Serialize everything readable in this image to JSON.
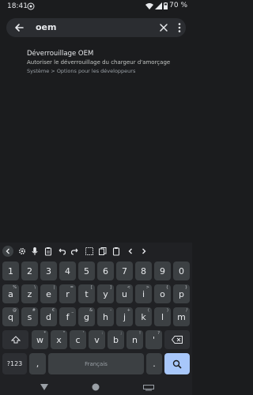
{
  "status": {
    "time": "18:41",
    "battery": "70 %"
  },
  "search": {
    "query": "oem"
  },
  "result": {
    "title": "Déverrouillage OEM",
    "summary": "Autoriser le déverrouillage du chargeur d'amorçage",
    "path": "Système > Options pour les développeurs"
  },
  "keyboard": {
    "row1": [
      {
        "main": "1",
        "hint": ""
      },
      {
        "main": "2",
        "hint": ""
      },
      {
        "main": "3",
        "hint": ""
      },
      {
        "main": "4",
        "hint": ""
      },
      {
        "main": "5",
        "hint": ""
      },
      {
        "main": "6",
        "hint": ""
      },
      {
        "main": "7",
        "hint": ""
      },
      {
        "main": "8",
        "hint": ""
      },
      {
        "main": "9",
        "hint": ""
      },
      {
        "main": "0",
        "hint": ""
      }
    ],
    "row2": [
      {
        "main": "a",
        "hint": "%"
      },
      {
        "main": "z",
        "hint": "\\"
      },
      {
        "main": "e",
        "hint": "|"
      },
      {
        "main": "r",
        "hint": "="
      },
      {
        "main": "t",
        "hint": "["
      },
      {
        "main": "y",
        "hint": "]"
      },
      {
        "main": "u",
        "hint": "<"
      },
      {
        "main": "i",
        "hint": ">"
      },
      {
        "main": "o",
        "hint": "{"
      },
      {
        "main": "p",
        "hint": "}"
      }
    ],
    "row3": [
      {
        "main": "q",
        "hint": "@"
      },
      {
        "main": "s",
        "hint": "#"
      },
      {
        "main": "d",
        "hint": "€"
      },
      {
        "main": "f",
        "hint": "_"
      },
      {
        "main": "g",
        "hint": "&"
      },
      {
        "main": "h",
        "hint": "-"
      },
      {
        "main": "j",
        "hint": "+"
      },
      {
        "main": "k",
        "hint": "("
      },
      {
        "main": "l",
        "hint": ")"
      },
      {
        "main": "m",
        "hint": "/"
      }
    ],
    "row4": [
      {
        "main": "w",
        "hint": "*"
      },
      {
        "main": "x",
        "hint": "\""
      },
      {
        "main": "c",
        "hint": "'"
      },
      {
        "main": "v",
        "hint": ":"
      },
      {
        "main": "b",
        "hint": ";"
      },
      {
        "main": "n",
        "hint": "!"
      },
      {
        "main": "'",
        "hint": "?"
      }
    ],
    "sym_label": "?123",
    "comma": ",",
    "space_label": "Français",
    "period": "."
  }
}
